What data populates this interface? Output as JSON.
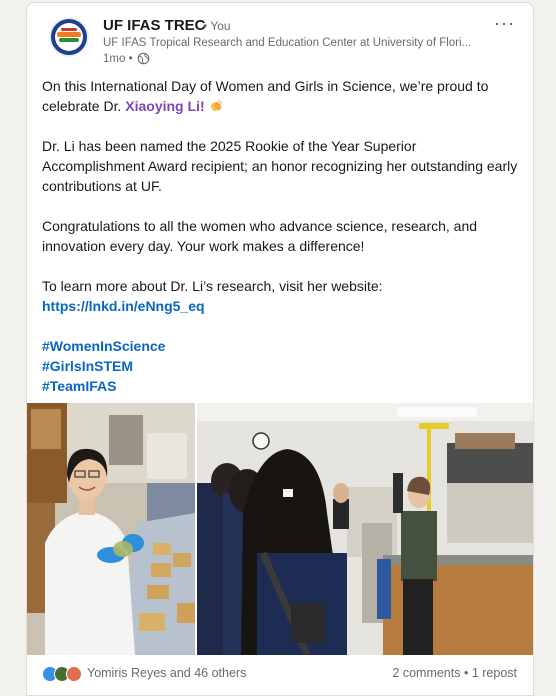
{
  "post": {
    "author_name": "UF IFAS TREC",
    "author_badge": "• You",
    "author_subtitle": "UF IFAS Tropical Research and Education Center at University of Flori...",
    "time_ago": "1mo •",
    "more_label": "···",
    "para1_a": "On this International Day of Women and Girls in Science, we’re proud to celebrate Dr. ",
    "para1_mention": "Xiaoying Li",
    "para1_b": "! ",
    "para2": "Dr. Li has been named the 2025 Rookie of the Year Superior Accomplishment Award recipient; an honor recognizing her outstanding early contributions at UF.",
    "para3": "Congratulations to all the women who advance science, research, and innovation every day. Your work makes a difference!",
    "para4_a": "To learn more about Dr. Li’s research, visit her website: ",
    "para4_link": "https://lnkd.in/eNng5_eq",
    "hashtags": [
      "#WomenInScience",
      "#GirlsInSTEM",
      "#TeamIFAS"
    ]
  },
  "social": {
    "reactions_text": "Yomiris Reyes and 46 others",
    "comments_text": "2 comments",
    "separator": " • ",
    "reposts_text": "1 repost"
  },
  "colors": {
    "link": "#0a66c2",
    "mention": "#7d45b8"
  }
}
